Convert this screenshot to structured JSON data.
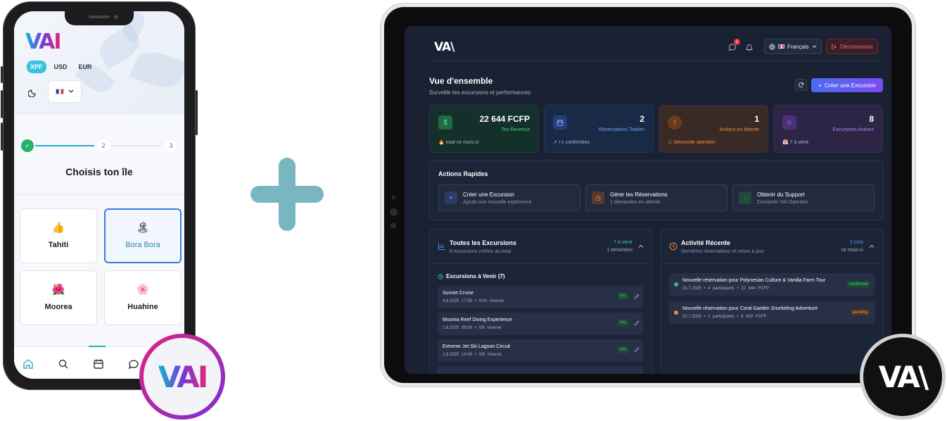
{
  "phone": {
    "logo": "VAI",
    "currencies": [
      "XPF",
      "USD",
      "EUR"
    ],
    "active_currency_index": 0,
    "flag": "FR",
    "steps": [
      "2",
      "3"
    ],
    "title": "Choisis ton île",
    "islands": [
      {
        "emoji": "👍",
        "name": "Tahiti",
        "selected": false
      },
      {
        "emoji": "🏝",
        "name": "Bora Bora",
        "selected": true
      },
      {
        "emoji": "🌺",
        "name": "Moorea",
        "selected": false
      },
      {
        "emoji": "🌸",
        "name": "Huahine",
        "selected": false
      }
    ],
    "tabs": [
      "home-icon",
      "search-icon",
      "calendar-icon",
      "chat-icon"
    ]
  },
  "tablet": {
    "logo": "VA\\",
    "notif_count": "1",
    "language": "Français",
    "logout": "Déconnexion",
    "title": "Vue d'ensemble",
    "subtitle": "Surveille tes excursions et performances",
    "create_button": "Créer une Excursion",
    "stats": [
      {
        "icon": "$",
        "value": "22 644 FCFP",
        "label": "Tes Revenus",
        "foot": "🔥 total  ce mois-ci",
        "accent": "#2fbf71",
        "bg": "#14302a"
      },
      {
        "icon": "calendar-icon",
        "value": "2",
        "label": "Réservations Totales",
        "foot": "↗ +1  confirmées",
        "accent": "#4f8ff0",
        "bg": "#192a46"
      },
      {
        "icon": "!",
        "value": "1",
        "label": "Actions en Attente",
        "foot": "⚠ Nécessite attention",
        "accent": "#f08a3a",
        "bg": "#3a2a26"
      },
      {
        "icon": "☆",
        "value": "8",
        "label": "Excursions Actives",
        "foot": "📅 7  à venir",
        "accent": "#9b6cf0",
        "bg": "#2c2546"
      }
    ],
    "quick_actions": {
      "title": "Actions Rapides",
      "items": [
        {
          "icon": "+",
          "title": "Créer une Excursion",
          "sub": "Ajoute une nouvelle expérience",
          "accent": "#4f8ff0",
          "bg": "#2b3d66"
        },
        {
          "icon": "◷",
          "title": "Gérer les Réservations",
          "sub": "1 demandes en attente",
          "accent": "#f08a3a",
          "bg": "#5a3a2a"
        },
        {
          "icon": "◌",
          "title": "Obtenir du Support",
          "sub": "Contacter VAI Operator",
          "accent": "#2fbf71",
          "bg": "#1f4a3a"
        }
      ]
    },
    "excursions": {
      "title": "Toutes les Excursions",
      "subtitle": "8 excursions créées au total",
      "right1": "7 à venir",
      "right2": "1 terminées",
      "upcoming_title": "Excursions à Venir (7)",
      "items": [
        {
          "name": "Sunset Cruise",
          "meta": "4.8.2025   17:30   •   0/10 réservé",
          "pct": "0%"
        },
        {
          "name": "Moorea Reef Diving Experience",
          "meta": "1.8.2025   09:00   •   0/6 réservé",
          "pct": "0%"
        },
        {
          "name": "Extreme Jet Ski Lagoon Circuit",
          "meta": "1.8.2025   14:00   •   0/8 réservé",
          "pct": "0%"
        }
      ]
    },
    "activity": {
      "title": "Activité Récente",
      "subtitle": "Dernières réservations et mises à jour",
      "right1": "2 total",
      "right2": "ce mois-ci",
      "items": [
        {
          "text": "Nouvelle réservation pour Polynesian Culture & Vanilla Farm Tour",
          "meta": "31.7.2025   •   4 participants   •   22 644 FCFP",
          "status": "confirmed",
          "dot": "#2fbf71",
          "status_color": "#43d17f",
          "status_bg": "#1d4a35"
        },
        {
          "text": "Nouvelle réservation pour Coral Garden Snorkeling Adventure",
          "meta": "31.7.2025   •   1 participants   •   6 600 FCFP",
          "status": "pending",
          "dot": "#f08a3a",
          "status_color": "#f0a35a",
          "status_bg": "#4a3222"
        }
      ]
    }
  },
  "badges": {
    "left": "VAI",
    "right": "VA\\"
  }
}
